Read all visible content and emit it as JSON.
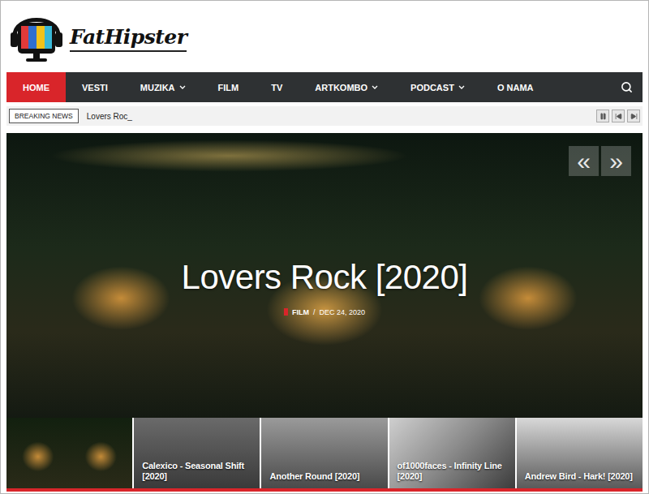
{
  "site": {
    "logo": "FatHipster"
  },
  "nav": {
    "items": [
      {
        "label": "HOME",
        "selected": true,
        "dropdown": false
      },
      {
        "label": "VESTI",
        "selected": false,
        "dropdown": false
      },
      {
        "label": "MUZIKA",
        "selected": false,
        "dropdown": true
      },
      {
        "label": "FILM",
        "selected": false,
        "dropdown": false
      },
      {
        "label": "TV",
        "selected": false,
        "dropdown": false
      },
      {
        "label": "ARTKOMBO",
        "selected": false,
        "dropdown": true
      },
      {
        "label": "PODCAST",
        "selected": false,
        "dropdown": true
      },
      {
        "label": "O NAMA",
        "selected": false,
        "dropdown": false
      }
    ]
  },
  "ticker": {
    "label": "BREAKING NEWS",
    "text": "Lovers Roc_"
  },
  "hero": {
    "title": "Lovers Rock [2020]",
    "category": "FILM",
    "separator": "/",
    "date": "DEC 24, 2020",
    "prev": "«",
    "next": "»"
  },
  "thumbnails": [
    {
      "selected": true
    },
    {
      "title": "Calexico - Seasonal Shift [2020]",
      "selected": false
    },
    {
      "title": "Another Round [2020]",
      "selected": false
    },
    {
      "title": "of1000faces - Infinity Line [2020]",
      "selected": false
    },
    {
      "title": "Andrew Bird - Hark! [2020]",
      "selected": false
    }
  ]
}
